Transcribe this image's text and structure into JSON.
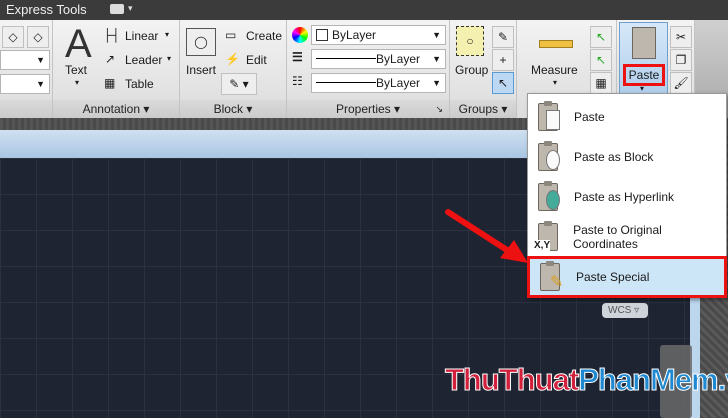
{
  "titlebar": {
    "tab": "Express Tools",
    "tab_icon": "ribbon-minimize-icon"
  },
  "ribbon": {
    "annotation": {
      "label": "Annotation",
      "text": "Text",
      "linear": "Linear",
      "leader": "Leader",
      "table": "Table"
    },
    "block": {
      "label": "Block",
      "insert": "Insert",
      "create": "Create",
      "edit": "Edit"
    },
    "properties": {
      "label": "Properties",
      "color": "ByLayer",
      "lineweight": "ByLayer",
      "linetype": "ByLayer"
    },
    "groups": {
      "label": "Groups",
      "group": "Group"
    },
    "utilities": {
      "measure": "Measure"
    },
    "clipboard": {
      "paste": "Paste"
    }
  },
  "menu": {
    "items": [
      {
        "label": "Paste"
      },
      {
        "label": "Paste as Block"
      },
      {
        "label": "Paste as Hyperlink"
      },
      {
        "label": "Paste to Original Coordinates",
        "badge": "X,Y"
      },
      {
        "label": "Paste Special"
      }
    ]
  },
  "viewport": {
    "wcs": "WCS"
  },
  "watermark": {
    "part1": "ThuThuat",
    "part2": "PhanMem.vn"
  },
  "colors": {
    "highlight": "#ff0000",
    "wm_red": "#d21f3c",
    "wm_blue": "#1e88d0"
  }
}
